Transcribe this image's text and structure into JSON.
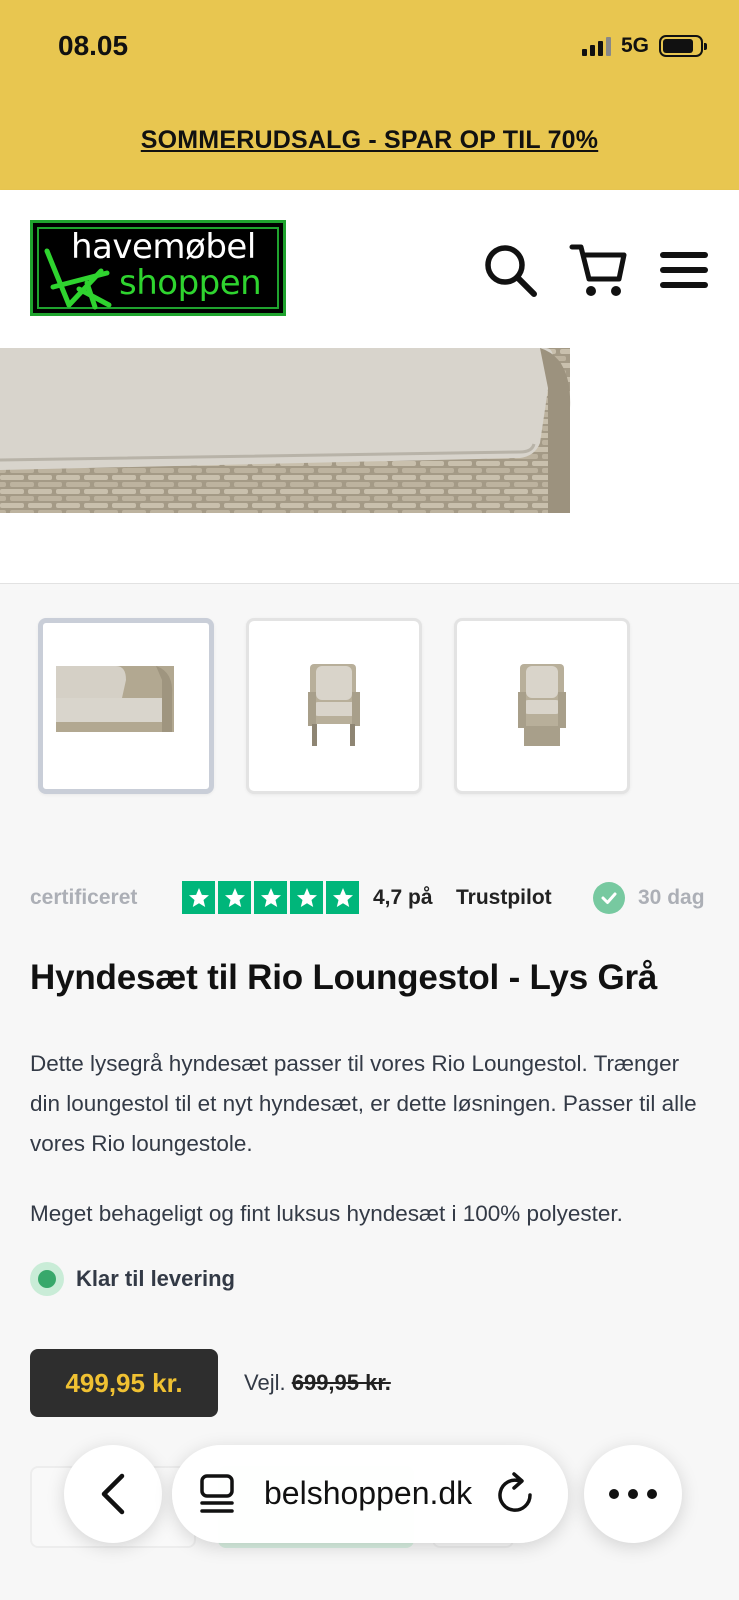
{
  "status_bar": {
    "time": "08.05",
    "network": "5G"
  },
  "promo": {
    "text": "SOMMERUDSALG - SPAR OP TIL 70%"
  },
  "logo": {
    "line1": "havemøbel",
    "line2": "shoppen"
  },
  "header": {
    "icons": [
      "search-icon",
      "cart-icon",
      "menu-icon"
    ]
  },
  "gallery": {
    "thumbnails": [
      "thumb-1",
      "thumb-2",
      "thumb-3"
    ],
    "active_index": 0
  },
  "trust_bar": {
    "left_fragment": "certificeret",
    "rating": "4,7 på",
    "brand": "Trustpilot",
    "right_fragment": "30 dag",
    "stars": 5,
    "star_color": "#00b67a"
  },
  "product": {
    "title": "Hyndesæt til Rio Loungestol - Lys Grå",
    "description": "Dette lysegrå hyndesæt passer til vores Rio Loungestol. Trænger din loungestol til et nyt hyndesæt, er dette løsningen. Passer til alle vores Rio loungestole.",
    "description2": "Meget behageligt og fint luksus hyndesæt i 100% polyester.",
    "stock_label": "Klar til levering",
    "price": "499,95 kr.",
    "rrp_prefix": "Vejl.",
    "rrp": "699,95 kr."
  },
  "browser_bar": {
    "url": "belshoppen.dk",
    "icons": [
      "back-icon",
      "tabs-icon",
      "reload-icon",
      "more-icon"
    ]
  },
  "colors": {
    "promo_bg": "#e8c650",
    "price_text": "#f0c132",
    "price_bg": "#2e2e2e",
    "stock_green": "#38a86b"
  }
}
